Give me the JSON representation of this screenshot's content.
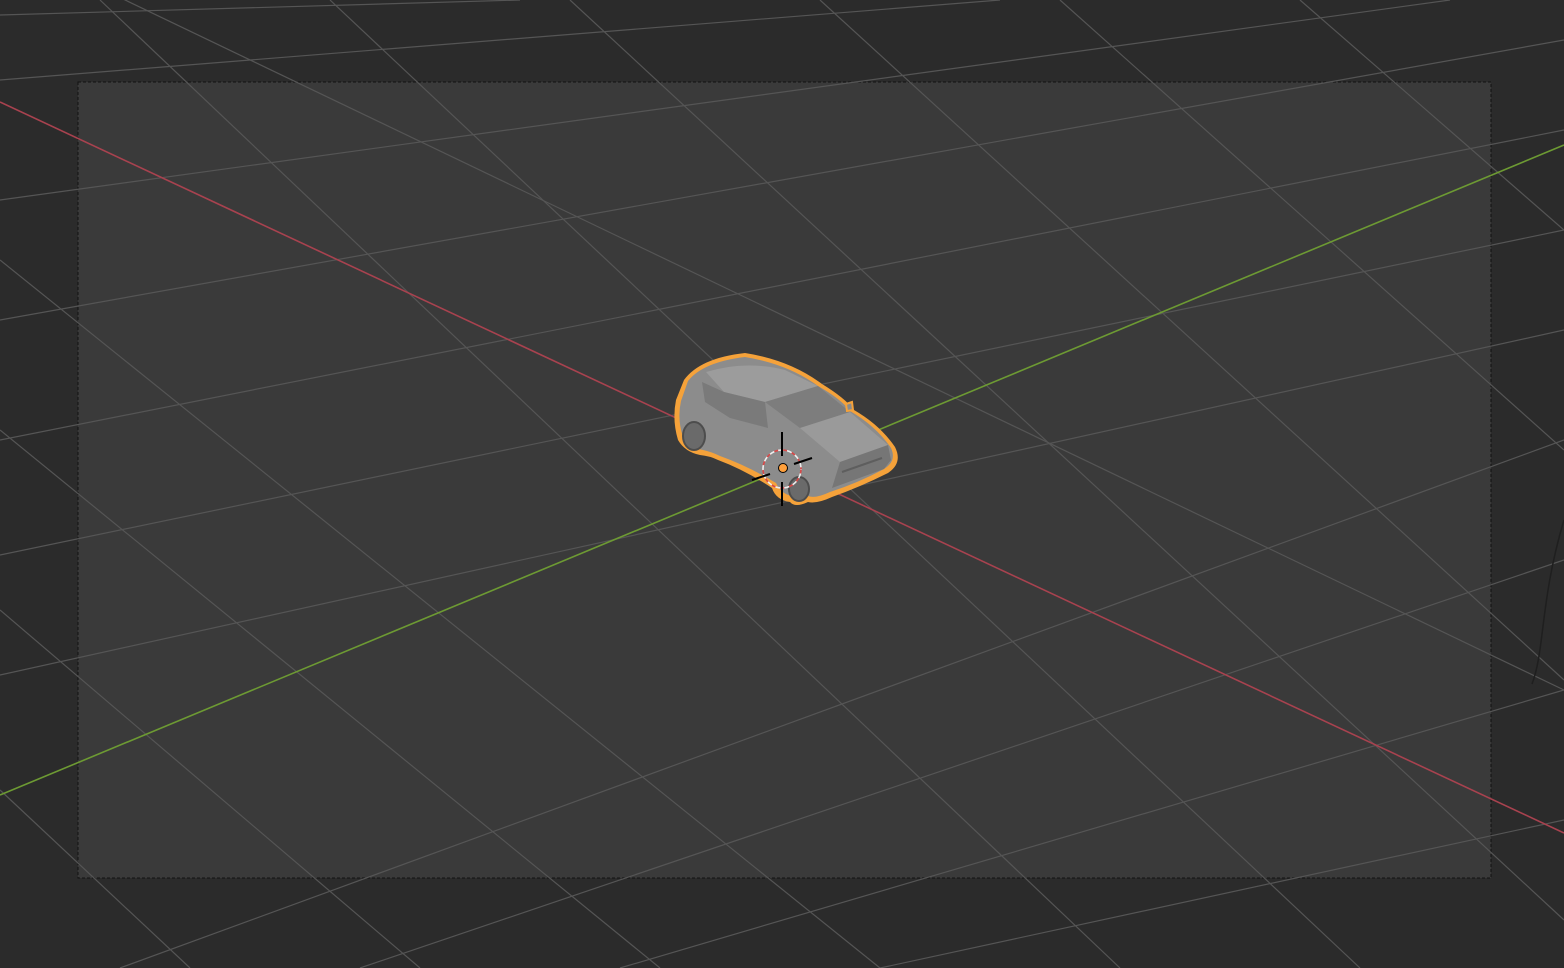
{
  "app": "3D Viewport",
  "viewport": {
    "background_color": "#2b2b2b",
    "camera_frame_fill": "#3a3a3a",
    "camera_frame_border": "#111111",
    "grid_color": "#505050",
    "x_axis_color": "#a8424f",
    "y_axis_color": "#6d9a33",
    "selection_outline_color": "#f5a23a"
  },
  "scene": {
    "selected_object": "car",
    "object_color": "#8c8c8c",
    "origin_color": "#ffa03c",
    "cursor_color": "#d94848"
  }
}
